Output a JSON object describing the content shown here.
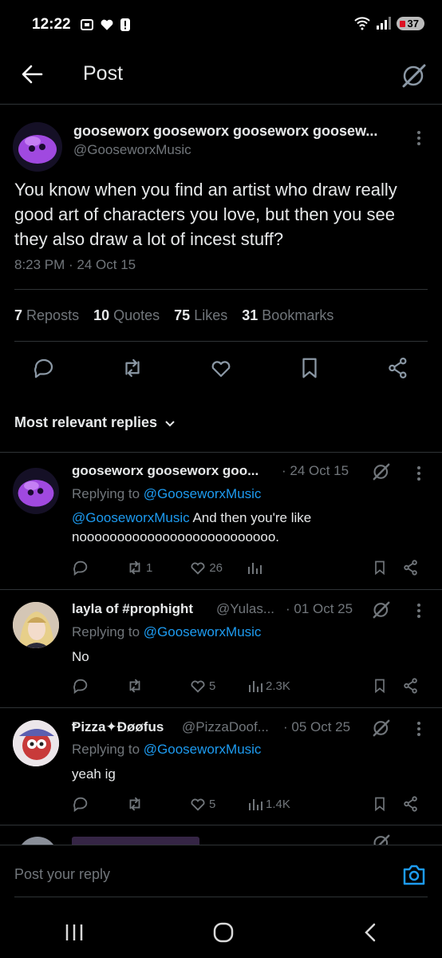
{
  "status_bar": {
    "time": "12:22",
    "battery": "37"
  },
  "header": {
    "title": "Post"
  },
  "post": {
    "author_name": "gooseworx gooseworx gooseworx goosew...",
    "author_handle": "@GooseworxMusic",
    "text": "You know when you find an artist who draw really good art of characters you love, but then you see they also draw a lot of incest stuff?",
    "timestamp": "8:23 PM · 24 Oct 15",
    "stats": {
      "reposts_count": "7",
      "reposts_label": "Reposts",
      "quotes_count": "10",
      "quotes_label": "Quotes",
      "likes_count": "75",
      "likes_label": "Likes",
      "bookmarks_count": "31",
      "bookmarks_label": "Bookmarks"
    }
  },
  "replies_sort": {
    "label": "Most relevant replies"
  },
  "replies": [
    {
      "name": "gooseworx gooseworx goo...",
      "date": "· 24 Oct 15",
      "replying_prefix": "Replying to",
      "replying_handle": "@GooseworxMusic",
      "mention": "@GooseworxMusic",
      "text": "And then you're like",
      "text2": "noooooooooooooooooooooooooo.",
      "reposts": "1",
      "likes": "26",
      "views": ""
    },
    {
      "name": "layla of #prophight",
      "handle": "@Yulas...",
      "date": "· 01 Oct 25",
      "replying_prefix": "Replying to",
      "replying_handle": "@GooseworxMusic",
      "text": "No",
      "reposts": "",
      "likes": "5",
      "views": "2.3K"
    },
    {
      "name": "Ᵽizza✦Đøøfus",
      "handle": "@PizzaDoof...",
      "date": "· 05 Oct 25",
      "replying_prefix": "Replying to",
      "replying_handle": "@GooseworxMusic",
      "text": "yeah ig",
      "reposts": "",
      "likes": "5",
      "views": "1.4K"
    }
  ],
  "compose": {
    "placeholder": "Post your reply"
  },
  "colors": {
    "background": "#000000",
    "accent": "#1d9bf0",
    "muted": "#71767b"
  }
}
